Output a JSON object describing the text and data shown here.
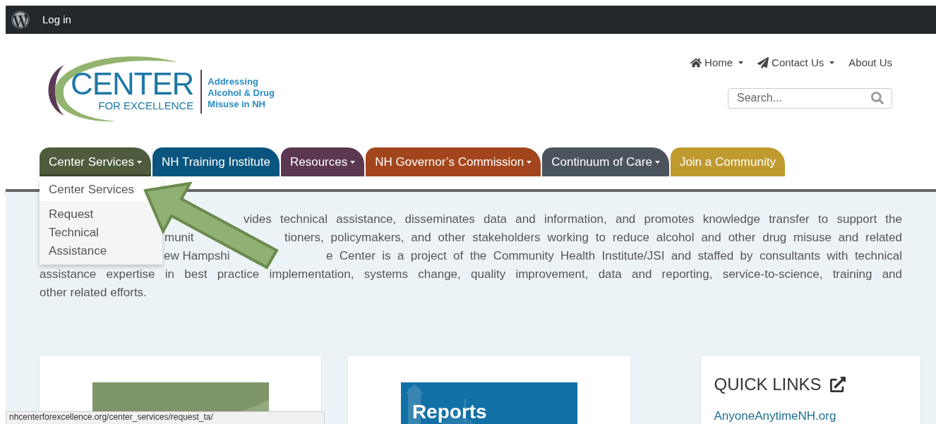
{
  "admin_bar": {
    "login": "Log in"
  },
  "logo": {
    "title": "CENTER",
    "subtitle": "FOR EXCELLENCE",
    "tagline": [
      "Addressing",
      "Alcohol & Drug",
      "Misuse in NH"
    ]
  },
  "top_links": [
    {
      "label": "Home",
      "kind": "home",
      "caret": true
    },
    {
      "label": "Contact Us",
      "kind": "contact",
      "caret": true
    },
    {
      "label": "About Us",
      "kind": "plain",
      "caret": false
    }
  ],
  "search": {
    "placeholder": "Search..."
  },
  "nav": [
    {
      "label": "Center Services",
      "caret": true,
      "color": "#4e5b3d",
      "expanded": true
    },
    {
      "label": "NH Training Institute",
      "caret": false,
      "color": "#09557f",
      "expanded": false
    },
    {
      "label": "Resources",
      "caret": true,
      "color": "#5b3750",
      "expanded": false
    },
    {
      "label": "NH Governor’s Commission",
      "caret": true,
      "color": "#a3451c",
      "expanded": false
    },
    {
      "label": "Continuum of Care",
      "caret": true,
      "color": "#4b545c",
      "expanded": false
    },
    {
      "label": "Join a Community",
      "caret": false,
      "color": "#bf9a2f",
      "expanded": false
    }
  ],
  "dropdown": [
    {
      "label": "Center Services",
      "selected": false
    },
    {
      "label": "Request Technical Assistance",
      "selected": true
    }
  ],
  "intro_lines": [
    [
      "vides technical assistance, disseminates data and information, and promotes knowledge transfer to support the"
    ],
    [
      "munit",
      "tioners, policymakers, and other stakeholders working to reduce alcohol and other drug misuse and related"
    ],
    [
      "ew Hampshi",
      "e Center is a project of the Community Health Institute/JSI and staffed by consultants with technical"
    ],
    [
      "assistance expertise in best practice implementation, systems change, quality improvement, data and reporting, service-to-science, training and"
    ],
    [
      "other related efforts."
    ]
  ],
  "cards": [
    {
      "kind": "picture"
    },
    {
      "kind": "picture",
      "caption": "Reports"
    }
  ],
  "quick_links": {
    "title": "QUICK LINKS",
    "links": [
      "AnyoneAnytimeNH.org"
    ]
  },
  "status_url": "nhcenterforexcellence.org/center_services/request_ta/"
}
